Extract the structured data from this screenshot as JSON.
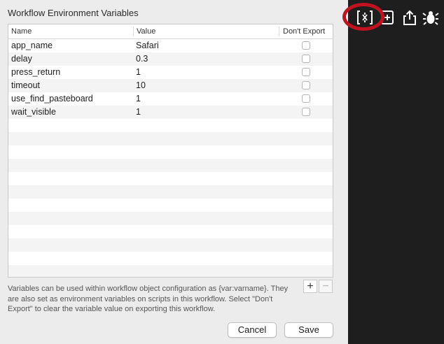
{
  "dialog": {
    "title": "Workflow Environment Variables",
    "columns": {
      "name": "Name",
      "value": "Value",
      "export": "Don't Export"
    },
    "rows": [
      {
        "name": "app_name",
        "value": "Safari",
        "dont_export": false
      },
      {
        "name": "delay",
        "value": "0.3",
        "dont_export": false
      },
      {
        "name": "press_return",
        "value": "1",
        "dont_export": false
      },
      {
        "name": "timeout",
        "value": "10",
        "dont_export": false
      },
      {
        "name": "use_find_pasteboard",
        "value": "1",
        "dont_export": false
      },
      {
        "name": "wait_visible",
        "value": "1",
        "dont_export": false
      }
    ],
    "add_label": "+",
    "remove_label": "−",
    "help_text": "Variables can be used within workflow object configuration as {var:varname}. They are also set as environment variables on scripts in this workflow. Select \"Don't Export\" to clear the variable value on exporting this workflow.",
    "cancel_label": "Cancel",
    "save_label": "Save"
  },
  "toolbar": {
    "icons": [
      "variables-icon",
      "add-object-icon",
      "share-icon",
      "debug-bug-icon"
    ],
    "highlight_color": "#c0121f",
    "background": "#1e1e1e"
  }
}
